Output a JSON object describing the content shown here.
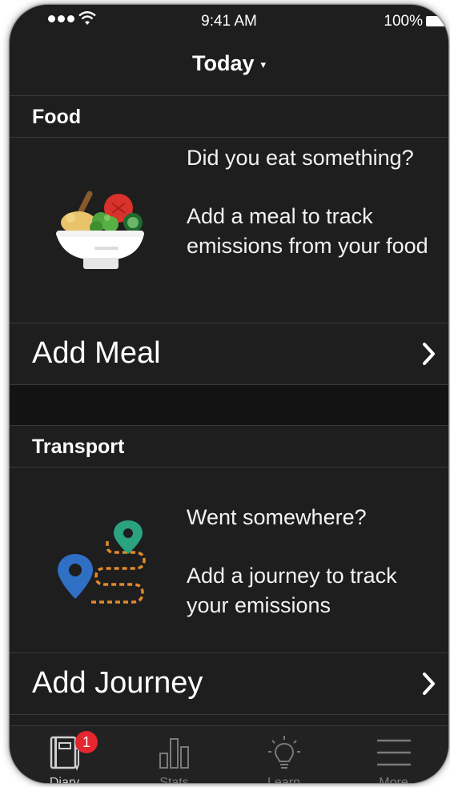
{
  "status_bar": {
    "time": "9:41 AM",
    "battery": "100%"
  },
  "nav": {
    "title": "Today",
    "caret": "▾"
  },
  "food": {
    "header": "Food",
    "prompt": "Did you eat something?",
    "description": "Add a meal to track emissions from your food",
    "action_label": "Add Meal",
    "icon": "food-bowl-icon"
  },
  "transport": {
    "header": "Transport",
    "prompt": "Went somewhere?",
    "description": "Add a journey to track your emissions",
    "action_label": "Add Journey",
    "icon": "journey-map-icon"
  },
  "tabs": [
    {
      "label": "Diary",
      "icon": "diary-icon",
      "badge": "1",
      "active": true
    },
    {
      "label": "Stats",
      "icon": "bar-chart-icon",
      "active": false
    },
    {
      "label": "Learn",
      "icon": "lightbulb-icon",
      "active": false
    },
    {
      "label": "More",
      "icon": "menu-icon",
      "active": false
    }
  ],
  "colors": {
    "background": "#1e1e1e",
    "badge": "#e3262f",
    "pin_green": "#2aa37e",
    "pin_blue": "#2f6fc4",
    "route_orange": "#e08a2c"
  }
}
